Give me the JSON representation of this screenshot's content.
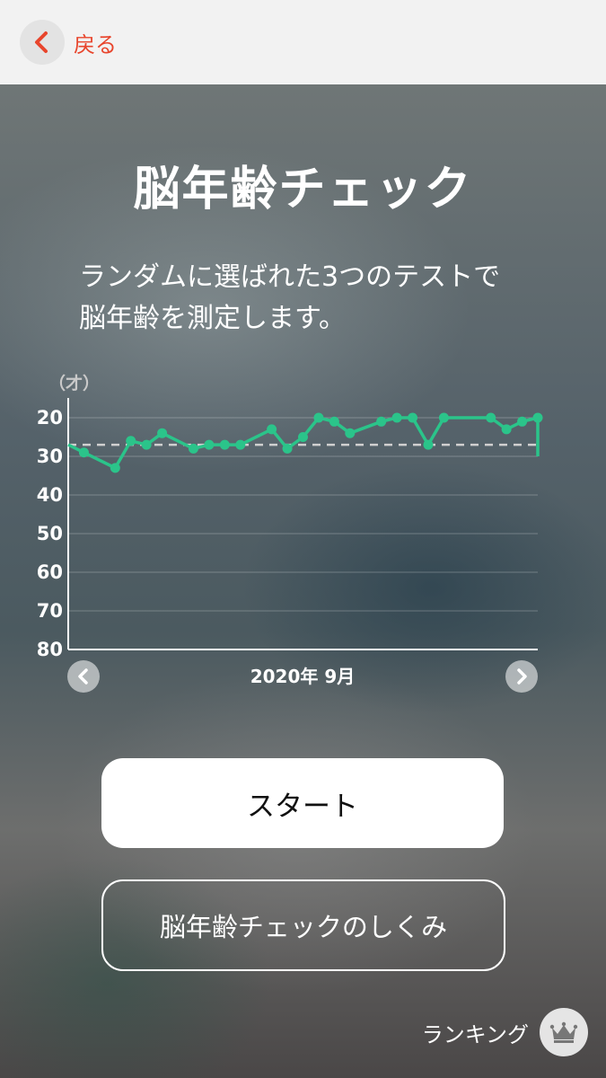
{
  "header": {
    "back_label": "戻る"
  },
  "title": "脳年齢チェック",
  "description": [
    "ランダムに選ばれた3つのテストで",
    "脳年齢を測定します。"
  ],
  "chart_data": {
    "type": "line",
    "unit_label": "（才）",
    "y_ticks": [
      "20",
      "30",
      "40",
      "50",
      "60",
      "70",
      "80"
    ],
    "ylim": [
      20,
      80
    ],
    "y_inverted": true,
    "x_label": "2020年 9月",
    "xlim": [
      1,
      31
    ],
    "reference_value": 27,
    "color": "#2bc48a",
    "line_start": 27,
    "line_end": 30,
    "points": [
      {
        "day": 2,
        "age": 29
      },
      {
        "day": 4,
        "age": 33
      },
      {
        "day": 5,
        "age": 26
      },
      {
        "day": 6,
        "age": 27
      },
      {
        "day": 7,
        "age": 24
      },
      {
        "day": 9,
        "age": 28
      },
      {
        "day": 10,
        "age": 27
      },
      {
        "day": 11,
        "age": 27
      },
      {
        "day": 12,
        "age": 27
      },
      {
        "day": 14,
        "age": 23
      },
      {
        "day": 15,
        "age": 28
      },
      {
        "day": 16,
        "age": 25
      },
      {
        "day": 17,
        "age": 20
      },
      {
        "day": 18,
        "age": 21
      },
      {
        "day": 19,
        "age": 24
      },
      {
        "day": 21,
        "age": 21
      },
      {
        "day": 22,
        "age": 20
      },
      {
        "day": 23,
        "age": 20
      },
      {
        "day": 24,
        "age": 27
      },
      {
        "day": 25,
        "age": 20
      },
      {
        "day": 28,
        "age": 20
      },
      {
        "day": 29,
        "age": 23
      },
      {
        "day": 30,
        "age": 21
      },
      {
        "day": 31,
        "age": 20
      }
    ]
  },
  "buttons": {
    "start": "スタート",
    "howto": "脳年齢チェックのしくみ",
    "ranking": "ランキング"
  }
}
